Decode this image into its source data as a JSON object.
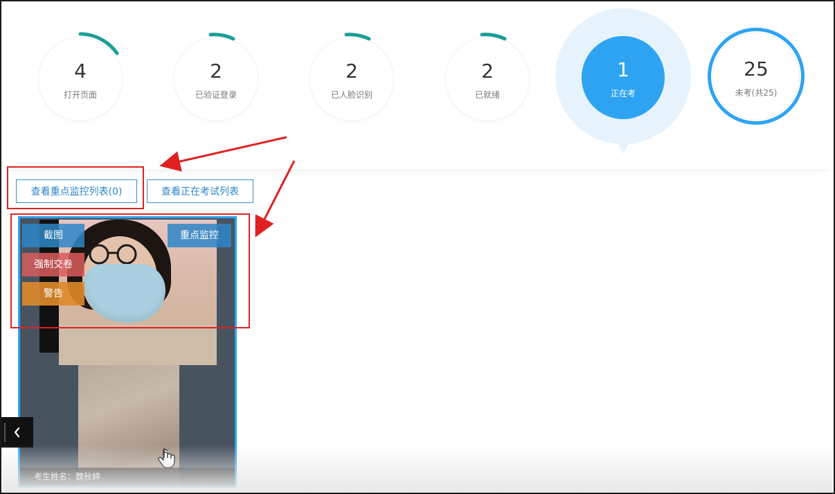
{
  "stats": [
    {
      "count": "4",
      "label": "打开页面"
    },
    {
      "count": "2",
      "label": "已验证登录"
    },
    {
      "count": "2",
      "label": "已人脸识别"
    },
    {
      "count": "2",
      "label": "已就绪"
    },
    {
      "count": "1",
      "label": "正在考"
    },
    {
      "count": "25",
      "label": "未考(共25)"
    }
  ],
  "colors": {
    "accent": "#2ea3f2",
    "arc": "#1a9e96",
    "highlight_box": "#e02020",
    "btn_blue": "#3a8fd0",
    "btn_red": "#d95c5c",
    "btn_orange": "#e0892a"
  },
  "buttons": {
    "key_monitor_list": "查看重点监控列表(0)",
    "in_exam_list": "查看正在考试列表"
  },
  "card": {
    "screenshot": "截图",
    "key_monitor": "重点监控",
    "force_submit": "强制交卷",
    "warning": "警告",
    "name_label": "考生姓名：",
    "name_value": "魏秋婷"
  },
  "icons": {
    "collapse": "chevron-left-icon",
    "cursor": "hand-pointer-icon"
  }
}
